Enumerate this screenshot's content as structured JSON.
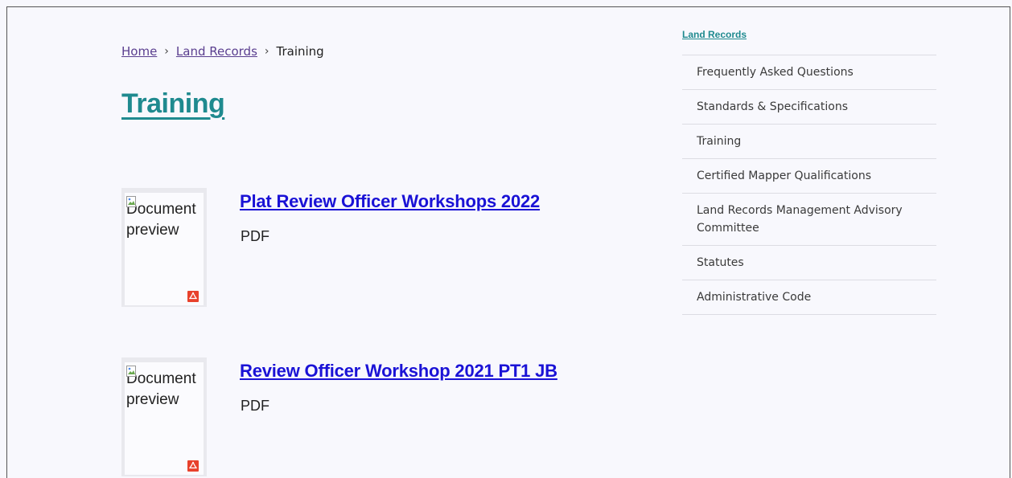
{
  "breadcrumb": {
    "home": "Home",
    "land_records": "Land Records",
    "current": "Training",
    "separator": "›"
  },
  "page_title": "Training",
  "documents": [
    {
      "title": "Plat Review Officer Workshops 2022",
      "type": "PDF",
      "thumb_alt": "Document preview"
    },
    {
      "title": "Review Officer Workshop 2021 PT1 JB",
      "type": "PDF",
      "thumb_alt": "Document preview"
    }
  ],
  "sidebar": {
    "heading": "Land Records",
    "items": [
      {
        "label": "Frequently Asked Questions"
      },
      {
        "label": "Standards & Specifications"
      },
      {
        "label": "Training"
      },
      {
        "label": "Certified Mapper Qualifications"
      },
      {
        "label": "Land Records Management Advisory Committee"
      },
      {
        "label": "Statutes"
      },
      {
        "label": "Administrative Code"
      }
    ]
  },
  "colors": {
    "background": "#f8f8fd",
    "title_teal": "#1f8a8f",
    "link_blue": "#1a12d6",
    "breadcrumb_link": "#5a3e8f",
    "pdf_red": "#e8412c"
  },
  "icons": {
    "thumb_broken": "broken-image-icon",
    "file_type": "pdf-icon"
  }
}
